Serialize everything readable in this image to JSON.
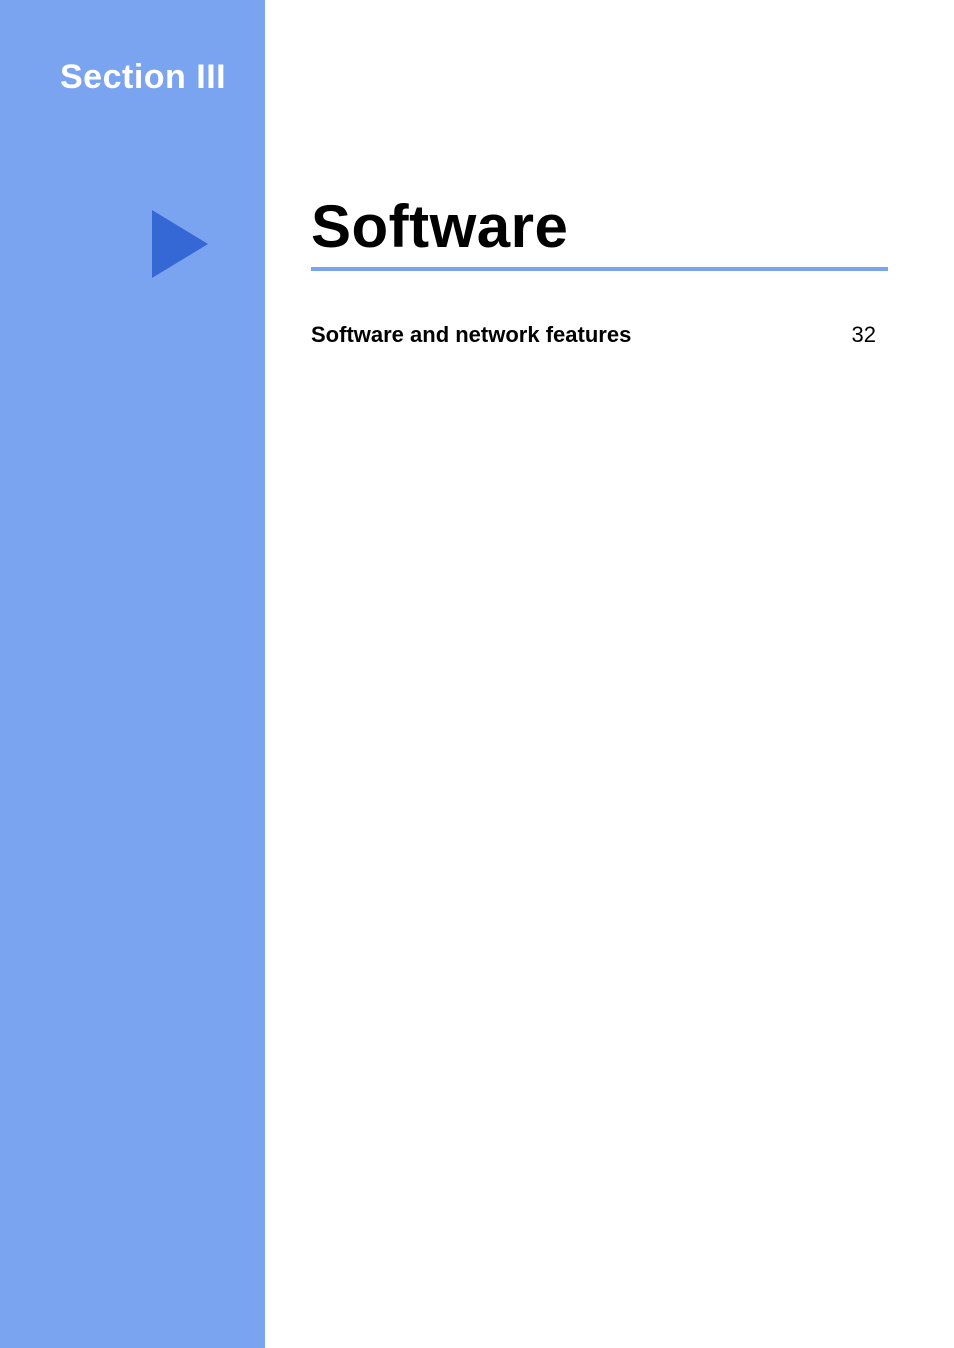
{
  "sidebar": {
    "section_label": "Section III"
  },
  "main": {
    "title": "Software",
    "toc": [
      {
        "label": "Software and network features",
        "page": "32"
      }
    ]
  },
  "colors": {
    "sidebar_bg": "#7ba4f0",
    "triangle": "#3568d4",
    "rule": "#7ba4f0"
  }
}
